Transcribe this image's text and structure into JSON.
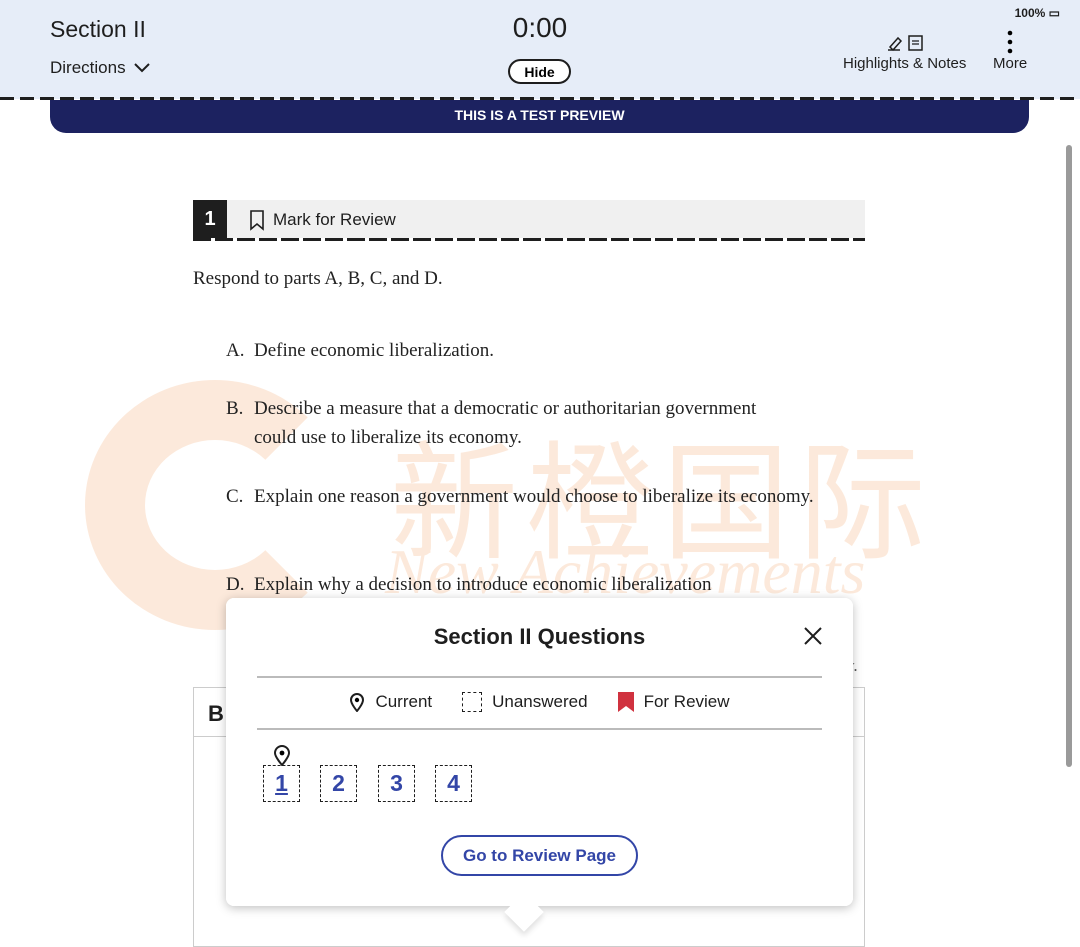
{
  "header": {
    "section_title": "Section II",
    "directions_label": "Directions",
    "timer": "0:00",
    "hide_label": "Hide",
    "battery": "100%",
    "highlights_label": "Highlights & Notes",
    "more_label": "More"
  },
  "banner": "THIS IS A TEST PREVIEW",
  "watermark": {
    "cn": "新橙国际",
    "en": "New Achievements"
  },
  "question": {
    "number": "1",
    "mark_label": "Mark for Review",
    "prompt": "Respond to parts A, B, C, and D.",
    "parts": [
      {
        "letter": "A.",
        "text": "Define economic liberalization."
      },
      {
        "letter": "B.",
        "text": "Describe a measure that a democratic or authoritarian government could use to liberalize its economy."
      },
      {
        "letter": "C.",
        "text": "Explain one reason a government would choose to liberalize its economy."
      },
      {
        "letter": "D.",
        "text": "Explain why a decision to introduce economic liberalization"
      }
    ],
    "tail": "y.",
    "answer_header": "B"
  },
  "popup": {
    "title": "Section II Questions",
    "legend": {
      "current": "Current",
      "unanswered": "Unanswered",
      "review": "For Review"
    },
    "questions": [
      "1",
      "2",
      "3",
      "4"
    ],
    "current": "1",
    "review_button": "Go to Review Page",
    "review_color": "#d0323f",
    "accent": "#3346a7"
  }
}
